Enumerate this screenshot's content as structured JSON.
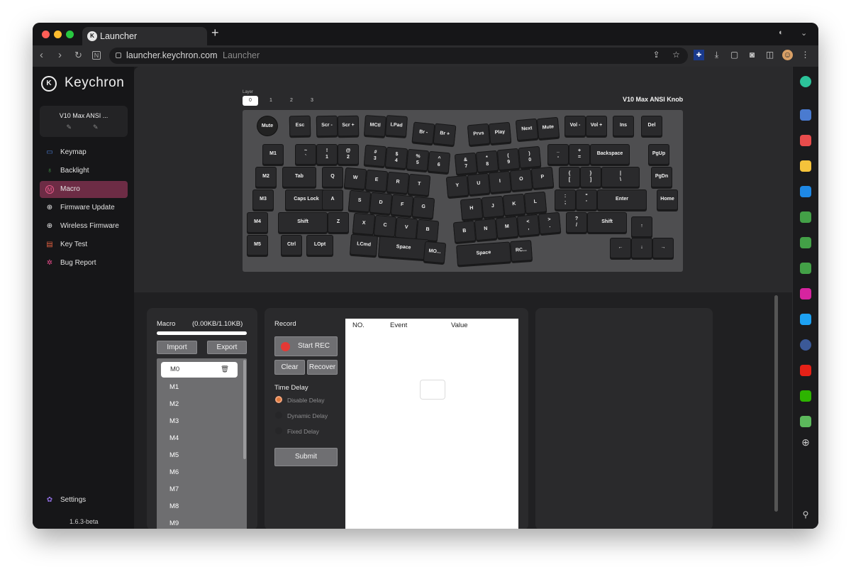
{
  "browser": {
    "tab_title": "Launcher",
    "new_tab": "+",
    "url_host": "launcher.keychron.com",
    "url_title": "Launcher"
  },
  "app": {
    "brand": "Keychron",
    "device_name": "V10 Max ANSI ...",
    "version": "1.6.3-beta",
    "menu": [
      {
        "label": "Keymap",
        "icon": "keyboard-icon"
      },
      {
        "label": "Backlight",
        "icon": "bulb-icon"
      },
      {
        "label": "Macro",
        "icon": "macro-icon"
      },
      {
        "label": "Firmware Update",
        "icon": "update-icon"
      },
      {
        "label": "Wireless Firmware",
        "icon": "wireless-icon"
      },
      {
        "label": "Key Test",
        "icon": "test-icon"
      },
      {
        "label": "Bug Report",
        "icon": "bug-icon"
      }
    ],
    "settings": "Settings"
  },
  "keyboard": {
    "layer_label": "Layer",
    "layers": [
      "0",
      "1",
      "2",
      "3"
    ],
    "title": "V10 Max ANSI Knob",
    "knob": "Mute",
    "keys": [
      "Esc",
      "Scr -",
      "Scr +",
      "MCtl",
      "LPad",
      "Br -",
      "Br +",
      "Prvs",
      "Play",
      "Next",
      "Mute",
      "Vol -",
      "Vol +",
      "Ins",
      "Del",
      "M1",
      "~\n`",
      "!\n1",
      "@\n2",
      "#\n3",
      "$\n4",
      "%\n5",
      "^\n6",
      "&\n7",
      "*\n8",
      "(\n9",
      ")\n0",
      "_\n-",
      "+\n=",
      "Backspace",
      "PgUp",
      "M2",
      "Tab",
      "Q",
      "W",
      "E",
      "R",
      "T",
      "Y",
      "U",
      "I",
      "O",
      "P",
      "{\n[",
      "}\n]",
      "|\n\\",
      "PgDn",
      "M3",
      "Caps Lock",
      "A",
      "S",
      "D",
      "F",
      "G",
      "H",
      "J",
      "K",
      "L",
      ":\n;",
      "\"\n'",
      "Enter",
      "Home",
      "M4",
      "Shift",
      "Z",
      "X",
      "C",
      "V",
      "B",
      "B",
      "N",
      "M",
      "<\n,",
      ">\n.",
      "?\n/",
      "Shift",
      "↑",
      "M5",
      "Ctrl",
      "LOpt",
      "LCmd",
      "Space",
      "MO...",
      "Space",
      "RC...",
      "←",
      "↓",
      "→"
    ]
  },
  "macro": {
    "title": "Macro",
    "usage": "(0.00KB/1.10KB)",
    "import": "Import",
    "export": "Export",
    "items": [
      "M0",
      "M1",
      "M2",
      "M3",
      "M4",
      "M5",
      "M6",
      "M7",
      "M8",
      "M9"
    ]
  },
  "record": {
    "title": "Record",
    "start": "Start REC",
    "clear": "Clear",
    "recover": "Recover",
    "time_delay": "Time Delay",
    "options": [
      "Disable Delay",
      "Dynamic Delay",
      "Fixed Delay"
    ],
    "submit": "Submit",
    "columns": [
      "NO.",
      "Event",
      "Value"
    ]
  },
  "colors": {
    "accent": "#6d2c45",
    "selected_key": "#8a5745",
    "rec": "#e53935"
  }
}
